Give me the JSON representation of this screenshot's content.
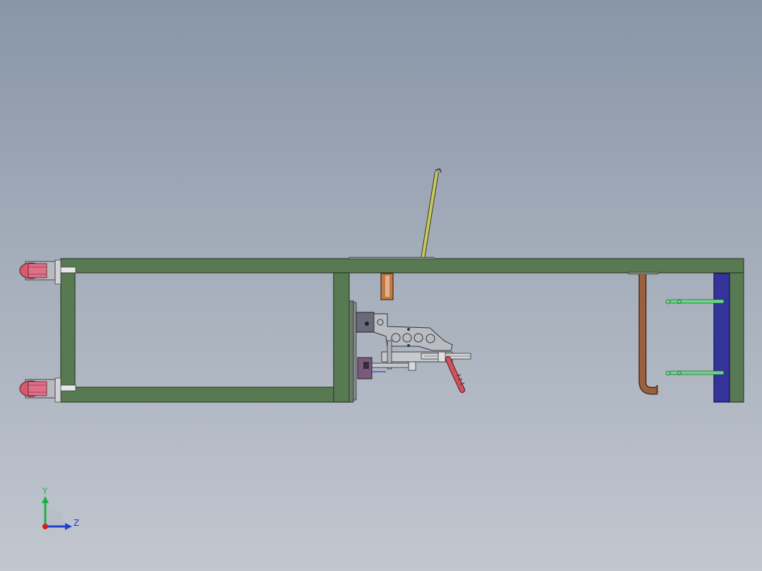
{
  "viewport": {
    "background_top": "#8896a8",
    "background_bottom": "#c2c7cf"
  },
  "colors": {
    "frame": "#587a52",
    "frame_edge": "#2e3e2c",
    "blue_plate": "#33339a",
    "copper": "#b06a3a",
    "pipe": "#8a5a3a",
    "green_pin": "#6fd48a",
    "red_cap": "#d45a70",
    "rod": "#c8c860",
    "gray_part": "#b9bcc2",
    "handle": "#c44a55"
  },
  "triad": {
    "y_label": "Y",
    "z_label": "Z",
    "x_color": "#d02020",
    "y_color": "#20b040",
    "z_color": "#2040d0"
  }
}
